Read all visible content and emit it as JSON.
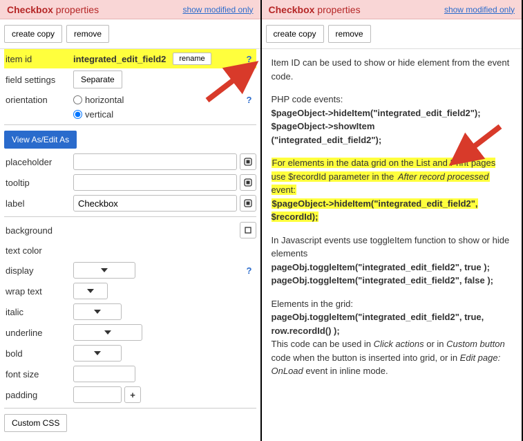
{
  "header": {
    "title_bold": "Checkbox",
    "title_rest": " properties",
    "link": "show modified only"
  },
  "buttons": {
    "create_copy": "create copy",
    "remove": "remove"
  },
  "fields": {
    "item_id": {
      "label": "item id",
      "value": "integrated_edit_field2",
      "rename": "rename"
    },
    "field_settings": {
      "label": "field settings",
      "button": "Separate"
    },
    "orientation": {
      "label": "orientation",
      "horizontal": "horizontal",
      "vertical": "vertical"
    },
    "view_as": "View As/Edit As",
    "placeholder": {
      "label": "placeholder"
    },
    "tooltip": {
      "label": "tooltip"
    },
    "label_field": {
      "label": "label",
      "value": "Checkbox"
    },
    "background": {
      "label": "background"
    },
    "text_color": {
      "label": "text color"
    },
    "display": {
      "label": "display"
    },
    "wrap_text": {
      "label": "wrap text"
    },
    "italic": {
      "label": "italic"
    },
    "underline": {
      "label": "underline"
    },
    "bold": {
      "label": "bold"
    },
    "font_size": {
      "label": "font size"
    },
    "padding": {
      "label": "padding"
    },
    "custom_css": "Custom CSS"
  },
  "help_q": "?",
  "plus": "+",
  "doc": {
    "p1": "Item ID can be used to show or hide element from the event code.",
    "p2a": "PHP code events:",
    "p2b": "$pageObject->hideItem(\"integrated_edit_field2\");",
    "p2c": "$pageObject->showItem",
    "p2d": "(\"integrated_edit_field2\");",
    "p3a": "For elements in the data grid on the List and Print pages use $recordId parameter in the ",
    "p3b": "After record processed",
    "p3c": " event:",
    "p3d": "$pageObject->hideItem(\"integrated_edit_field2\", $recordId);",
    "p4a": "In Javascript events use toggleItem function to show or hide elements",
    "p4b": "pageObj.toggleItem(\"integrated_edit_field2\", true );",
    "p4c": "pageObj.toggleItem(\"integrated_edit_field2\", false );",
    "p5a": "Elements in the grid:",
    "p5b": "pageObj.toggleItem(\"integrated_edit_field2\", true, row.recordId() );",
    "p5c1": "This code can be used in ",
    "p5c2": "Click actions",
    "p5c3": " or in ",
    "p5c4": "Custom button",
    "p5c5": " code when the button is inserted into grid, or in ",
    "p5c6": "Edit page: OnLoad",
    "p5c7": " event in inline mode."
  }
}
